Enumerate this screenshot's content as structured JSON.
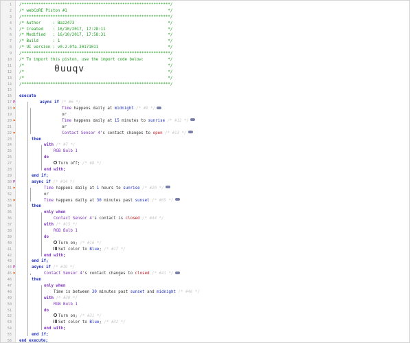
{
  "lines": [
    {
      "n": "1",
      "cls": "c",
      "text": "/**************************************************************/"
    },
    {
      "n": "2",
      "cls": "c",
      "text": "/* webCoRE Piston #1                                          */"
    },
    {
      "n": "3",
      "cls": "c",
      "text": "/**************************************************************/"
    },
    {
      "n": "4",
      "cls": "c",
      "text": "/* Author     : Baz2473                                       */"
    },
    {
      "n": "5",
      "cls": "c",
      "text": "/* Created    : 16/10/2017, 17:28:11                          */"
    },
    {
      "n": "6",
      "cls": "c",
      "text": "/* Modified   : 16/10/2017, 17:58:31                          */"
    },
    {
      "n": "7",
      "cls": "c",
      "text": "/* Build      : 1                                             */"
    },
    {
      "n": "8",
      "cls": "c",
      "text": "/* UI version : v0.2.0fa.20171011                             */"
    },
    {
      "n": "9",
      "cls": "c",
      "text": "/**************************************************************/"
    },
    {
      "n": "10",
      "cls": "c",
      "text": "/* To import this piston, use the import code below:          */"
    },
    {
      "n": "11",
      "cls": "c",
      "text": "/*                                                            */"
    },
    {
      "n": "12",
      "cls": "c",
      "text": "/*                                                            */"
    },
    {
      "n": "13",
      "cls": "c",
      "text": "/*                                                            */"
    },
    {
      "n": "14",
      "cls": "c",
      "text": "/**************************************************************/"
    },
    {
      "n": "15",
      "text": ""
    },
    {
      "n": "16",
      "text": ""
    },
    {
      "n": "17",
      "mark": "P"
    },
    {
      "n": "18",
      "mark": "flag"
    },
    {
      "n": "19"
    },
    {
      "n": "20",
      "mark": "flag"
    },
    {
      "n": "21"
    },
    {
      "n": "22",
      "mark": "flag"
    },
    {
      "n": "23"
    },
    {
      "n": "24"
    },
    {
      "n": "25"
    },
    {
      "n": "26"
    },
    {
      "n": "27"
    },
    {
      "n": "28"
    },
    {
      "n": "29"
    },
    {
      "n": "30",
      "mark": "P"
    },
    {
      "n": "31",
      "mark": "flag"
    },
    {
      "n": "32"
    },
    {
      "n": "33",
      "mark": "flag"
    },
    {
      "n": "34"
    },
    {
      "n": "35"
    },
    {
      "n": "36"
    },
    {
      "n": "37"
    },
    {
      "n": "38"
    },
    {
      "n": "39"
    },
    {
      "n": "40"
    },
    {
      "n": "41"
    },
    {
      "n": "42"
    },
    {
      "n": "43"
    },
    {
      "n": "44",
      "mark": "P"
    },
    {
      "n": "45",
      "mark": "flag"
    },
    {
      "n": "46"
    },
    {
      "n": "47"
    },
    {
      "n": "48"
    },
    {
      "n": "49"
    },
    {
      "n": "50"
    },
    {
      "n": "51"
    },
    {
      "n": "52"
    },
    {
      "n": "53"
    },
    {
      "n": "54"
    },
    {
      "n": "55"
    },
    {
      "n": "56"
    }
  ],
  "import_code": "0uuqv",
  "code": {
    "execute": "execute",
    "async_if": "async if",
    "hint_1": "/* #6 */",
    "time": "Time",
    "happens_daily_at": " happens daily at ",
    "midnight": "midnight",
    "hint_2": "/* #9 */",
    "or": "or",
    "n15": "15",
    "minutes": " minutes",
    "to": " to ",
    "sunrise": "sunrise",
    "hint_3": "/* #12 */",
    "contact_sensor_4": "Contact Sensor 4",
    "s_contact_changes_to": "'s contact changes to ",
    "open": "open",
    "hint_4": "/* #13 */",
    "then": "then",
    "with": "with",
    "hint_5": "/* #7 */",
    "rgb_bulb_1": "RGB Bulb 1",
    "do": "do",
    "turn_off": "Turn off;",
    "hint_6": "/* #8 */",
    "end_with": "end with;",
    "end_if": "end if;",
    "hint_7": "/* #14 */",
    "n1": "1",
    "hours": " hours",
    "hint_8": "/* #20 */",
    "n30": "30",
    "past": " past ",
    "sunset": "sunset",
    "hint_9": "/* #65 */",
    "only_when": "only when",
    "s_contact_is": "'s contact is ",
    "closed": "closed",
    "hint_10": "/* #44 */",
    "hint_11": "/* #15 */",
    "turn_on": "Turn on;",
    "hint_12": "/* #16 */",
    "set_color_to": "Set color to ",
    "blue": "Blue",
    "hint_13": "/* #17 */",
    "hint_14": "/* #19 */",
    "changes_to": "'s contact changes to ",
    "hint_15": "/* #41 */",
    "time_is_between": "Time is between ",
    "n30b": "30",
    "minutes_past": " minutes past ",
    "and": " and ",
    "hint_16": "/* #46 */",
    "hint_17": "/* #30 */",
    "hint_18": "/* #31 */",
    "hint_19": "/* #32 */",
    "end_execute": "end execute;"
  }
}
